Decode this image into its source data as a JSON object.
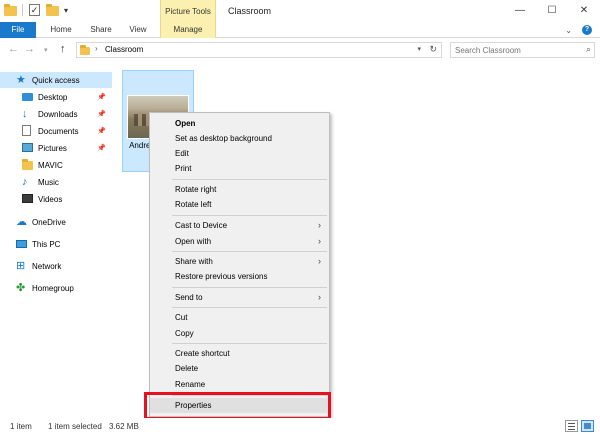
{
  "window": {
    "title": "Classroom",
    "contextual_tab_group": "Picture Tools",
    "controls": {
      "minimize": "—",
      "maximize": "☐",
      "close": "✕"
    }
  },
  "ribbon": {
    "tabs": [
      {
        "label": "File"
      },
      {
        "label": "Home"
      },
      {
        "label": "Share"
      },
      {
        "label": "View"
      },
      {
        "label": "Manage"
      }
    ]
  },
  "address": {
    "path": "Classroom",
    "search_placeholder": "Search Classroom"
  },
  "nav": {
    "items": [
      {
        "label": "Quick access",
        "icon": "star-icon"
      },
      {
        "label": "Desktop",
        "icon": "desktop-icon",
        "pinned": true
      },
      {
        "label": "Downloads",
        "icon": "download-icon",
        "pinned": true
      },
      {
        "label": "Documents",
        "icon": "document-icon",
        "pinned": true
      },
      {
        "label": "Pictures",
        "icon": "pictures-icon",
        "pinned": true
      },
      {
        "label": "MAVIC",
        "icon": "folder-icon"
      },
      {
        "label": "Music",
        "icon": "music-icon"
      },
      {
        "label": "Videos",
        "icon": "video-icon"
      },
      {
        "label": "OneDrive",
        "icon": "cloud-icon"
      },
      {
        "label": "This PC",
        "icon": "computer-icon"
      },
      {
        "label": "Network",
        "icon": "network-icon"
      },
      {
        "label": "Homegroup",
        "icon": "homegroup-icon"
      }
    ]
  },
  "file": {
    "name_visible": "Andre m_De_ ni"
  },
  "context_menu": {
    "items": [
      {
        "label": "Open",
        "bold": true
      },
      {
        "label": "Set as desktop background"
      },
      {
        "label": "Edit"
      },
      {
        "label": "Print"
      },
      {
        "label": "Rotate right"
      },
      {
        "label": "Rotate left"
      },
      {
        "label": "Cast to Device",
        "submenu": true
      },
      {
        "label": "Open with",
        "submenu": true
      },
      {
        "label": "Share with",
        "submenu": true
      },
      {
        "label": "Restore previous versions"
      },
      {
        "label": "Send to",
        "submenu": true
      },
      {
        "label": "Cut"
      },
      {
        "label": "Copy"
      },
      {
        "label": "Create shortcut"
      },
      {
        "label": "Delete"
      },
      {
        "label": "Rename"
      },
      {
        "label": "Properties",
        "highlighted": true
      }
    ],
    "submenu_arrow": "›",
    "highlight_color": "#e81123"
  },
  "status": {
    "item_count": "1 item",
    "selection": "1 item selected",
    "size": "3.62 MB"
  },
  "colors": {
    "accent": "#1979ca",
    "selection": "#cce8ff",
    "contextual_tab": "#fbf0b0"
  }
}
